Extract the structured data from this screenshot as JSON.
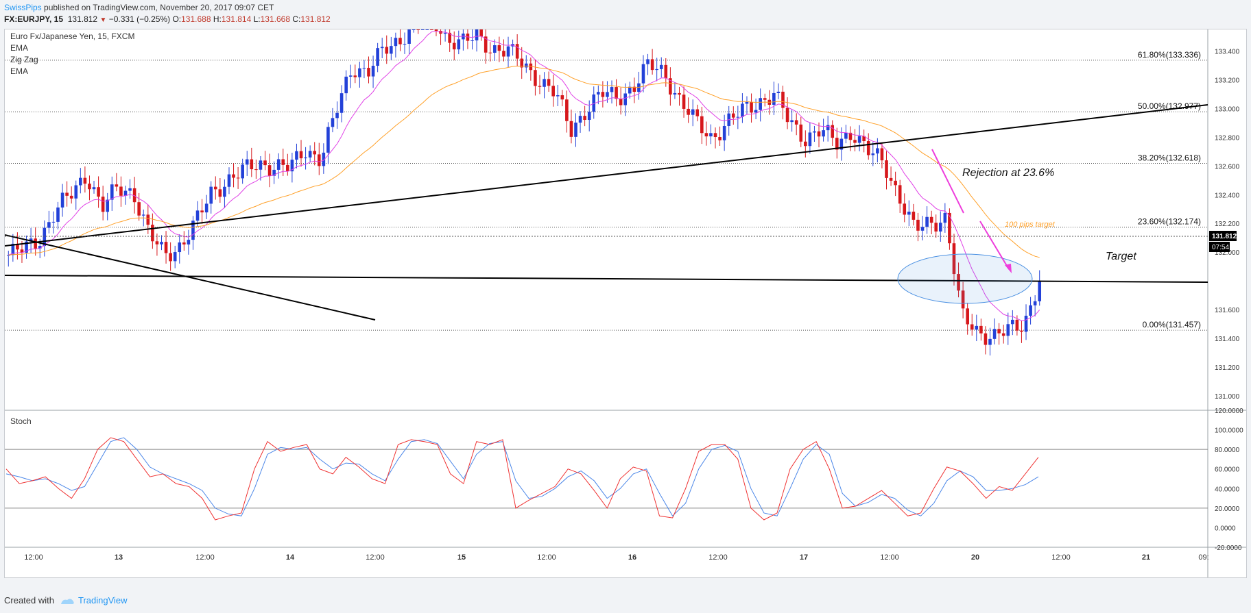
{
  "header": {
    "author": "SwissPips",
    "published_on": "published on TradingView.com, November 20, 2017 09:07 CET",
    "symbol": "FX:EURJPY, 15",
    "last": "131.812",
    "change": "−0.331 (−0.25%)",
    "o_label": "O:",
    "o": "131.688",
    "h_label": "H:",
    "h": "131.814",
    "l_label": "L:",
    "l": "131.668",
    "c_label": "C:",
    "c": "131.812"
  },
  "legend": [
    "Euro Fx/Japanese Yen, 15, FXCM",
    "EMA",
    "Zig Zag",
    "EMA"
  ],
  "stoch_label": "Stoch",
  "price_tag": "131.812",
  "countdown_tag": "07:54",
  "annotations": {
    "rejection": "Rejection at 23.6%",
    "target": "Target",
    "pips_target": "100 pips target"
  },
  "footer": {
    "created_with": "Created with",
    "brand": "TradingView"
  },
  "colors": {
    "up": "#2341d8",
    "down": "#d6171b",
    "ema_fast": "#e040e6",
    "ema_slow": "#ffa028",
    "stoch_k": "#ef3232",
    "stoch_d": "#4a86e8",
    "arrow": "#ee3ddc"
  },
  "chart_data": [
    {
      "type": "candlestick",
      "title": "Euro Fx/Japanese Yen, 15, FXCM",
      "ylim": [
        130.9,
        133.55
      ],
      "yticks": [
        "133.400",
        "133.200",
        "133.000",
        "132.800",
        "132.600",
        "132.400",
        "132.200",
        "132.000",
        "131.600",
        "131.400",
        "131.200",
        "131.000"
      ],
      "xticks": [
        "12:00",
        "13",
        "12:00",
        "14",
        "12:00",
        "15",
        "12:00",
        "16",
        "12:00",
        "17",
        "12:00",
        "20",
        "12:00",
        "21",
        "09:"
      ],
      "fib_levels": [
        {
          "label": "61.80%(133.336)",
          "value": 133.336
        },
        {
          "label": "50.00%(132.977)",
          "value": 132.977
        },
        {
          "label": "38.20%(132.618)",
          "value": 132.618
        },
        {
          "label": "23.60%(132.174)",
          "value": 132.174
        },
        {
          "label": "0.00%(131.457)",
          "value": 131.457
        }
      ],
      "last_price": 131.812,
      "close_series": [
        131.98,
        132.02,
        132.1,
        132.28,
        132.4,
        132.55,
        132.3,
        132.45,
        132.42,
        132.12,
        131.98,
        132.05,
        132.2,
        132.42,
        132.5,
        132.56,
        132.62,
        132.6,
        132.58,
        132.72,
        132.65,
        132.98,
        133.3,
        133.25,
        133.4,
        133.48,
        133.6,
        133.65,
        133.5,
        133.45,
        133.5,
        133.42,
        133.4,
        133.3,
        133.2,
        133.1,
        132.85,
        133.0,
        133.1,
        133.08,
        133.15,
        133.3,
        133.25,
        133.05,
        132.9,
        132.8,
        132.9,
        132.98,
        133.05,
        133.1,
        132.9,
        132.8,
        132.85,
        132.75,
        132.85,
        132.7,
        132.62,
        132.4,
        132.15,
        132.2,
        132.25,
        131.55,
        131.45,
        131.42,
        131.45,
        131.5,
        131.82
      ]
    },
    {
      "type": "line",
      "title": "Stoch",
      "ylim": [
        -20,
        120
      ],
      "yticks": [
        "120.0000",
        "100.0000",
        "80.0000",
        "60.0000",
        "40.0000",
        "20.0000",
        "0.0000",
        "-20.0000"
      ],
      "bands": [
        80,
        20
      ],
      "series": [
        {
          "values": [
            60,
            45,
            48,
            52,
            40,
            30,
            50,
            80,
            92,
            88,
            70,
            52,
            55,
            45,
            42,
            30,
            8,
            12,
            15,
            60,
            88,
            78,
            82,
            85,
            60,
            55,
            72,
            62,
            50,
            45,
            85,
            90,
            88,
            85,
            55,
            45,
            88,
            85,
            90,
            20,
            28,
            35,
            42,
            60,
            55,
            38,
            20,
            50,
            62,
            58,
            12,
            10,
            40,
            78,
            85,
            85,
            70,
            20,
            8,
            15,
            60,
            80,
            88,
            60,
            20,
            22,
            30,
            38,
            25,
            12,
            15,
            40,
            62,
            58,
            45,
            30,
            42,
            38,
            55,
            72
          ]
        },
        {
          "values": [
            55,
            52,
            48,
            50,
            45,
            38,
            42,
            65,
            88,
            92,
            80,
            62,
            55,
            50,
            45,
            38,
            20,
            14,
            12,
            40,
            75,
            82,
            80,
            82,
            70,
            60,
            66,
            65,
            55,
            48,
            70,
            88,
            90,
            86,
            68,
            50,
            75,
            86,
            88,
            48,
            30,
            32,
            40,
            52,
            58,
            48,
            30,
            40,
            55,
            60,
            35,
            12,
            25,
            60,
            80,
            84,
            78,
            40,
            15,
            12,
            40,
            70,
            85,
            75,
            35,
            22,
            26,
            34,
            30,
            18,
            12,
            25,
            48,
            58,
            52,
            38,
            38,
            40,
            44,
            52
          ]
        }
      ]
    }
  ]
}
